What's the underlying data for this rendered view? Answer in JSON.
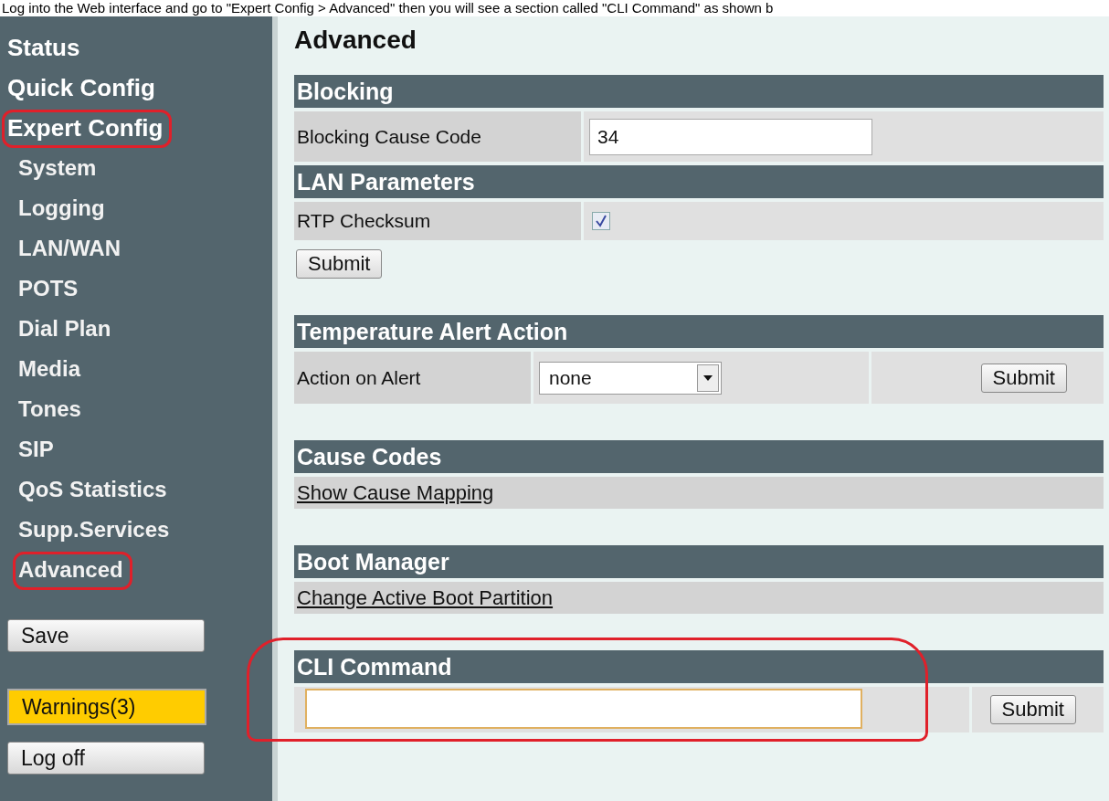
{
  "caption": "Log into the Web interface and go to \"Expert Config > Advanced\" then you will see a section called \"CLI Command\" as shown b",
  "sidebar": {
    "items": [
      {
        "label": "Status",
        "highlighted": false
      },
      {
        "label": "Quick Config",
        "highlighted": false
      },
      {
        "label": "Expert Config",
        "highlighted": true,
        "children": [
          {
            "label": "System",
            "highlighted": false
          },
          {
            "label": "Logging",
            "highlighted": false
          },
          {
            "label": "LAN/WAN",
            "highlighted": false
          },
          {
            "label": "POTS",
            "highlighted": false
          },
          {
            "label": "Dial Plan",
            "highlighted": false
          },
          {
            "label": "Media",
            "highlighted": false
          },
          {
            "label": "Tones",
            "highlighted": false
          },
          {
            "label": "SIP",
            "highlighted": false
          },
          {
            "label": "QoS Statistics",
            "highlighted": false
          },
          {
            "label": "Supp.Services",
            "highlighted": false
          },
          {
            "label": "Advanced",
            "highlighted": true
          }
        ]
      }
    ],
    "buttons": [
      {
        "label": "Save",
        "kind": "normal"
      },
      {
        "label": "Warnings(3)",
        "kind": "warning"
      },
      {
        "label": "Log off",
        "kind": "normal"
      }
    ]
  },
  "page_title": "Advanced",
  "groups": [
    {
      "blocks": [
        {
          "title": "Blocking",
          "highlighted": false,
          "rows": [
            {
              "kind": "text",
              "label": "Blocking Cause Code",
              "value": "34"
            }
          ]
        },
        {
          "title": "LAN Parameters",
          "highlighted": false,
          "rows": [
            {
              "kind": "checkbox",
              "label": "RTP Checksum",
              "checked": true
            }
          ]
        }
      ],
      "submit": "Submit"
    },
    {
      "blocks": [
        {
          "title": "Temperature Alert Action",
          "highlighted": false,
          "rows": [
            {
              "kind": "select",
              "label": "Action on Alert",
              "value": "none",
              "submit": "Submit"
            }
          ]
        }
      ]
    },
    {
      "blocks": [
        {
          "title": "Cause Codes",
          "highlighted": false,
          "rows": [
            {
              "kind": "link",
              "label": "Show Cause Mapping"
            }
          ]
        }
      ]
    },
    {
      "blocks": [
        {
          "title": "Boot Manager",
          "highlighted": false,
          "rows": [
            {
              "kind": "link",
              "label": "Change Active Boot Partition"
            }
          ]
        }
      ]
    },
    {
      "blocks": [
        {
          "title": "CLI Command",
          "highlighted": true,
          "rows": [
            {
              "kind": "command",
              "submit": "Submit"
            }
          ]
        }
      ]
    }
  ]
}
